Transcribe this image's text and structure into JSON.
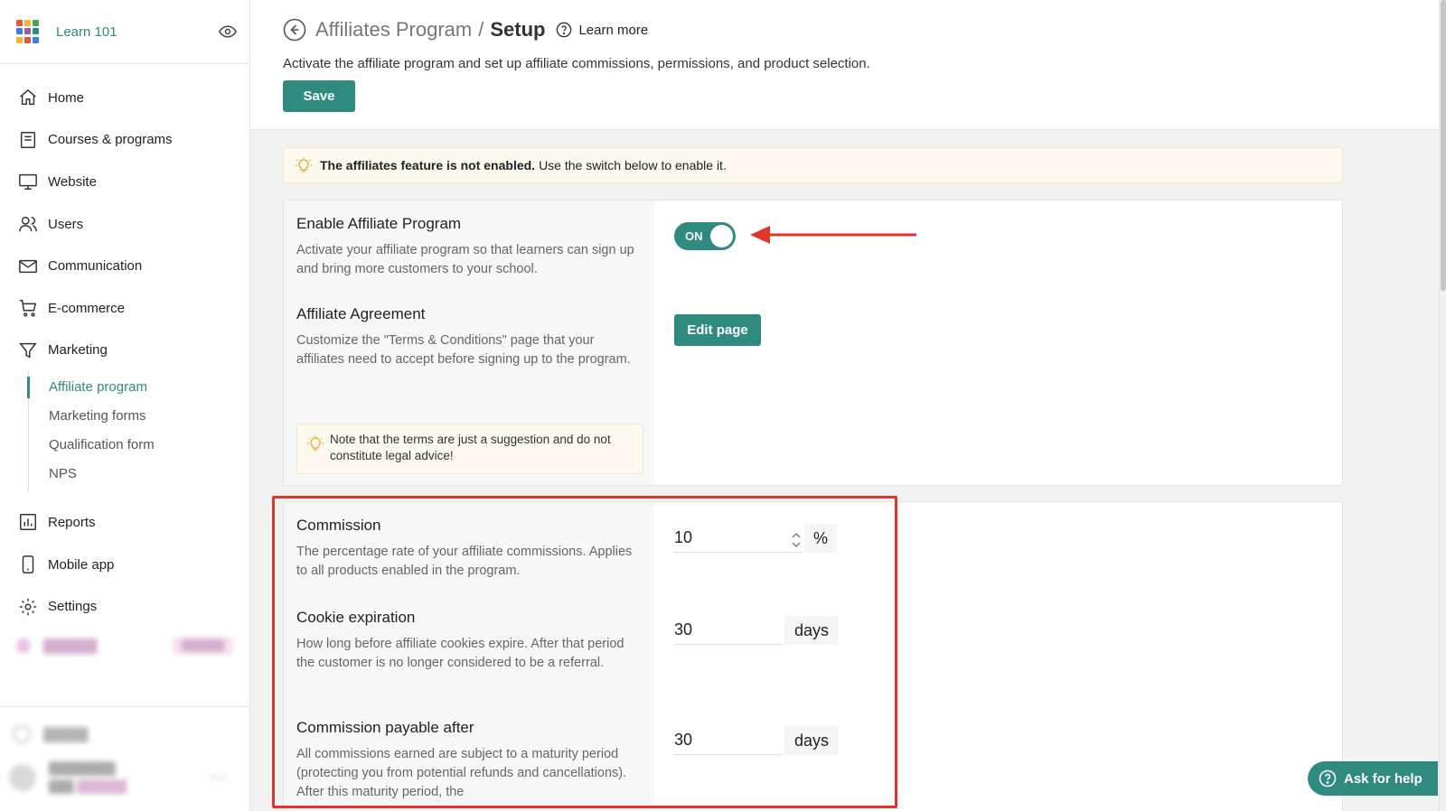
{
  "sidebar": {
    "school_name": "Learn 101",
    "nav": [
      {
        "label": "Home",
        "icon": "home-icon"
      },
      {
        "label": "Courses & programs",
        "icon": "courses-icon"
      },
      {
        "label": "Website",
        "icon": "monitor-icon"
      },
      {
        "label": "Users",
        "icon": "users-icon"
      },
      {
        "label": "Communication",
        "icon": "mail-icon"
      },
      {
        "label": "E-commerce",
        "icon": "cart-icon"
      },
      {
        "label": "Marketing",
        "icon": "funnel-icon"
      }
    ],
    "marketing_sub": [
      "Affiliate program",
      "Marketing forms",
      "Qualification form",
      "NPS"
    ],
    "nav_bottom": [
      {
        "label": "Reports",
        "icon": "reports-icon"
      },
      {
        "label": "Mobile app",
        "icon": "mobile-icon"
      },
      {
        "label": "Settings",
        "icon": "gear-icon"
      }
    ]
  },
  "header": {
    "crumb_parent": "Affiliates Program",
    "crumb_sep": "/",
    "crumb_current": "Setup",
    "learn_more": "Learn more",
    "description": "Activate the affiliate program and set up affiliate commissions, permissions, and product selection.",
    "save_label": "Save"
  },
  "notice": {
    "bold": "The affiliates feature is not enabled.",
    "text": "Use the switch below to enable it."
  },
  "enable": {
    "title": "Enable Affiliate Program",
    "desc": "Activate your affiliate program so that learners can sign up and bring more customers to your school.",
    "toggle_label": "ON"
  },
  "agreement": {
    "title": "Affiliate Agreement",
    "desc": "Customize the \"Terms & Conditions\" page that your affiliates need to accept before signing up to the program.",
    "edit_label": "Edit page",
    "note": "Note that the terms are just a suggestion and do not constitute legal advice!"
  },
  "commission": {
    "title": "Commission",
    "desc": "The percentage rate of your affiliate commissions. Applies to all products enabled in the program.",
    "value": "10",
    "unit": "%"
  },
  "cookie": {
    "title": "Cookie expiration",
    "desc": "How long before affiliate cookies expire. After that period the customer is no longer considered to be a referral.",
    "value": "30",
    "unit": "days"
  },
  "payable": {
    "title": "Commission payable after",
    "desc": "All commissions earned are subject to a maturity period (protecting you from potential refunds and cancellations). After this maturity period, the",
    "value": "30",
    "unit": "days"
  },
  "help_label": "Ask for help",
  "colors": {
    "accent": "#2f8a80",
    "annotation_red": "#e0352b"
  }
}
